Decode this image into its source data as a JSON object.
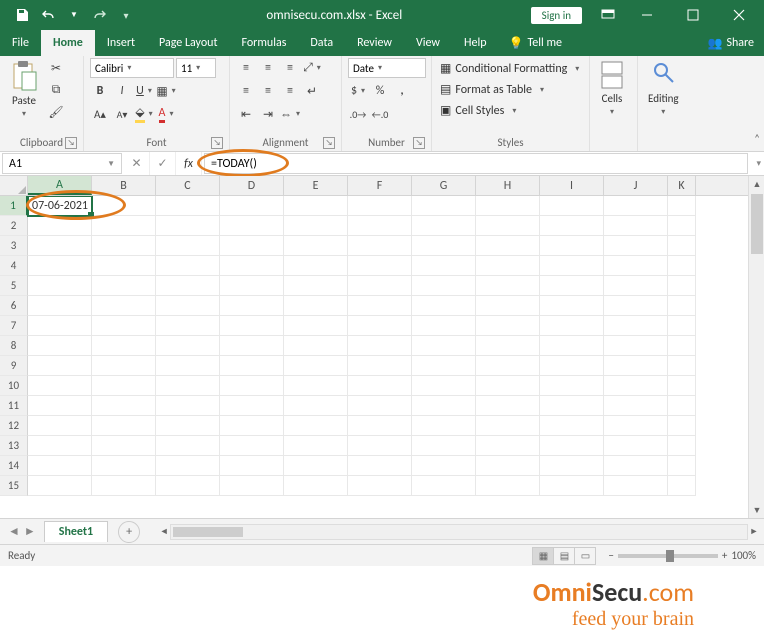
{
  "titlebar": {
    "doc_title": "omnisecu.com.xlsx - Excel",
    "signin": "Sign in"
  },
  "tabs": {
    "file": "File",
    "home": "Home",
    "insert": "Insert",
    "page_layout": "Page Layout",
    "formulas": "Formulas",
    "data": "Data",
    "review": "Review",
    "view": "View",
    "help": "Help",
    "tell_me": "Tell me",
    "share": "Share"
  },
  "ribbon": {
    "paste": "Paste",
    "clipboard": "Clipboard",
    "font_name": "Calibri",
    "font_size": "11",
    "font": "Font",
    "alignment": "Alignment",
    "number_format": "Date",
    "number": "Number",
    "cond_fmt": "Conditional Formatting",
    "fmt_table": "Format as Table",
    "cell_styles": "Cell Styles",
    "styles": "Styles",
    "cells": "Cells",
    "editing": "Editing"
  },
  "fx": {
    "name_box": "A1",
    "formula": "=TODAY()"
  },
  "grid": {
    "columns": [
      "A",
      "B",
      "C",
      "D",
      "E",
      "F",
      "G",
      "H",
      "I",
      "J",
      "K"
    ],
    "row_count": 15,
    "cell_A1": "07-06-2021"
  },
  "sheets": {
    "active": "Sheet1"
  },
  "status": {
    "ready": "Ready",
    "zoom": "100%"
  },
  "watermark": {
    "brand1": "Omni",
    "brand2": "Secu",
    "brand3": ".com",
    "tag": "feed your brain"
  }
}
